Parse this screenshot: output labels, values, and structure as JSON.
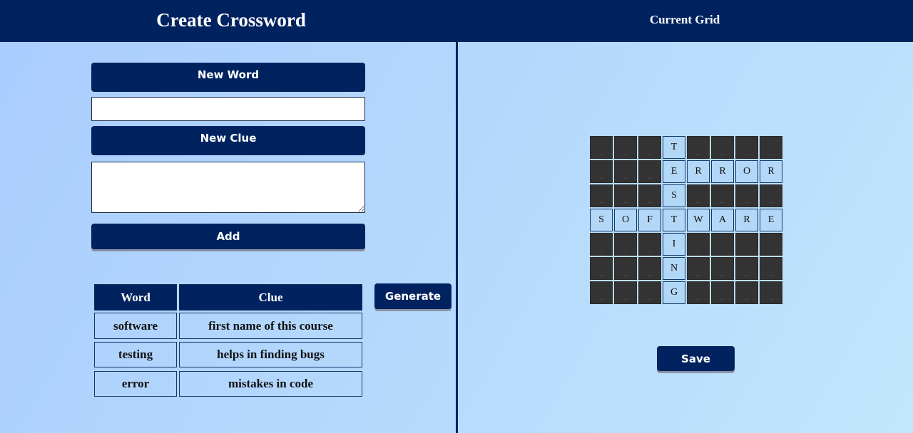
{
  "header": {
    "title": "Create Crossword",
    "grid_title": "Current Grid"
  },
  "form": {
    "new_word_label": "New Word",
    "word_value": "",
    "word_placeholder": "",
    "new_clue_label": "New Clue",
    "clue_value": "",
    "clue_placeholder": "",
    "add_label": "Add"
  },
  "table": {
    "headers": [
      "Word",
      "Clue"
    ],
    "rows": [
      [
        "software",
        "first name of this course"
      ],
      [
        "testing",
        "helps in finding bugs"
      ],
      [
        "error",
        "mistakes in code"
      ]
    ]
  },
  "generate_label": "Generate",
  "save_label": "Save",
  "grid": {
    "rows": [
      [
        "_",
        "_",
        "_",
        "T",
        "_",
        "_",
        "_",
        "_"
      ],
      [
        "_",
        "_",
        "_",
        "E",
        "R",
        "R",
        "O",
        "R"
      ],
      [
        "_",
        "_",
        "_",
        "S",
        "_",
        "_",
        "_",
        "_"
      ],
      [
        "S",
        "O",
        "F",
        "T",
        "W",
        "A",
        "R",
        "E"
      ],
      [
        "_",
        "_",
        "_",
        "I",
        "_",
        "_",
        "_",
        "_"
      ],
      [
        "_",
        "_",
        "_",
        "N",
        "_",
        "_",
        "_",
        "_"
      ],
      [
        "_",
        "_",
        "_",
        "G",
        "_",
        "_",
        "_",
        "_"
      ]
    ]
  },
  "colors": {
    "primary": "#002360",
    "letter_cell": "#b3d7f6",
    "blank_cell": "#333333"
  }
}
